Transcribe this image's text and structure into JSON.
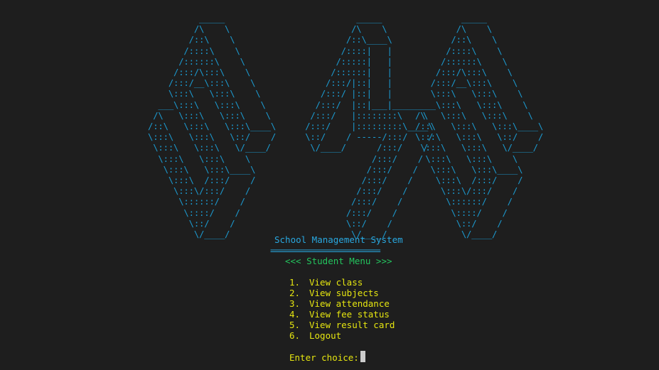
{
  "colors": {
    "background": "#1e1e1e",
    "ascii_art": "#1c9bd1",
    "title": "#29a8e0",
    "menu_heading": "#23c55e",
    "menu_text": "#e5e510",
    "cursor": "#cccccc"
  },
  "ascii_art": {
    "left": "          _____\n         /\\    \\\n        /::\\    \\\n       /::::\\    \\\n      /::::::\\    \\\n     /:::/\\:::\\    \\\n    /:::/__\\:::\\    \\\n    \\:::\\   \\:::\\    \\\n  ___\\:::\\   \\:::\\    \\\n /\\   \\:::\\   \\:::\\    \\\n/::\\   \\:::\\   \\:::\\____\\\n\\:::\\   \\:::\\   \\::/    /\n \\:::\\   \\:::\\   \\/____/\n  \\:::\\   \\:::\\    \\\n   \\:::\\   \\:::\\____\\\n    \\:::\\  /:::/    /\n     \\:::\\/:::/    /\n      \\::::::/    /\n       \\::::/    /\n        \\::/    /\n         \\/____/",
    "middle": "                _____\n               /\\    \\\n              /::\\____\\\n             /::::|   |\n            /:::::|   |\n           /::::::|   |\n          /:::/|::|   |\n         /:::/ |::|   |\n        /:::/  |::|___|______\n       /:::/   |::::::::\\    \\\n      /:::/    |:::::::::\\____\\\n      \\::/    / -----/:::/    /\n       \\/____/      /:::/    /\n                   /:::/    /\n                  /:::/    /\n                 /:::/    /\n                /:::/    /\n               /:::/    /\n              /:::/    /\n              \\::/    /\n               \\/____/",
    "right": "         _____\n        /\\    \\\n       /::\\    \\\n      /::::\\    \\\n     /::::::\\    \\\n    /:::/\\:::\\    \\\n   /:::/__\\:::\\    \\\n   \\:::\\   \\:::\\    \\\n ___\\:::\\   \\:::\\    \\\n/\\   \\:::\\   \\:::\\    \\\n/::\\   \\:::\\   \\:::\\____\\\n\\:::\\   \\:::\\   \\::/    /\n \\:::\\   \\:::\\   \\/____/\n  \\:::\\   \\:::\\    \\\n   \\:::\\   \\:::\\____\\\n    \\:::\\  /:::/    /\n     \\:::\\/:::/    /\n      \\::::::/    /\n       \\::::/    /\n        \\::/    /\n         \\/____/"
  },
  "title": "School Management System",
  "divider": "==========================",
  "menu_heading": "<<< Student Menu >>>",
  "menu_items": [
    {
      "number": "1.",
      "label": "View class"
    },
    {
      "number": "2.",
      "label": "View subjects"
    },
    {
      "number": "3.",
      "label": "View attendance"
    },
    {
      "number": "4.",
      "label": "View fee status"
    },
    {
      "number": "5.",
      "label": "View result card"
    },
    {
      "number": "6.",
      "label": "Logout"
    }
  ],
  "prompt": "Enter choice: "
}
